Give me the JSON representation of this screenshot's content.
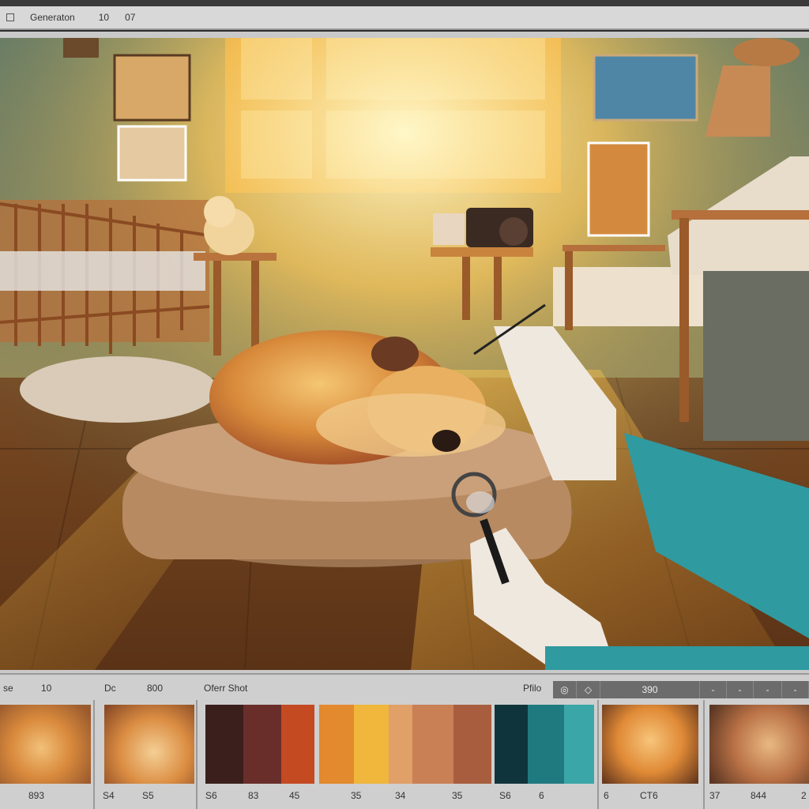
{
  "toolbar": {
    "title": "Generaton",
    "field_a": "10",
    "field_b": "07"
  },
  "scene": {
    "description_icon": "photo-canvas"
  },
  "filmstrip_header": {
    "label_1": "se",
    "label_2": "10",
    "label_3": "Dc",
    "label_4": "800",
    "label_5": "Oferr Shot",
    "label_6": "Pfilo",
    "control_value": "390"
  },
  "palette": {
    "group_1": [
      "#3a1f1c",
      "#6a2e2a",
      "#c44a22"
    ],
    "group_2": [
      "#e38a2e",
      "#f0b73c",
      "#e0a068",
      "#c98055",
      "#a85e3e"
    ],
    "group_3": [
      "#10343c",
      "#1f7a80",
      "#3aa6a8"
    ]
  },
  "strip_labels": {
    "l1": "893",
    "l2": "S4",
    "l3": "S5",
    "l4": "S6",
    "l5": "83",
    "l6": "45",
    "l7": "35",
    "l8": "34",
    "l9": "35",
    "l10": "S6",
    "l11": "6",
    "l12": "6",
    "l13": "CT6",
    "l14": "37",
    "l15": "844",
    "l16": "2"
  }
}
